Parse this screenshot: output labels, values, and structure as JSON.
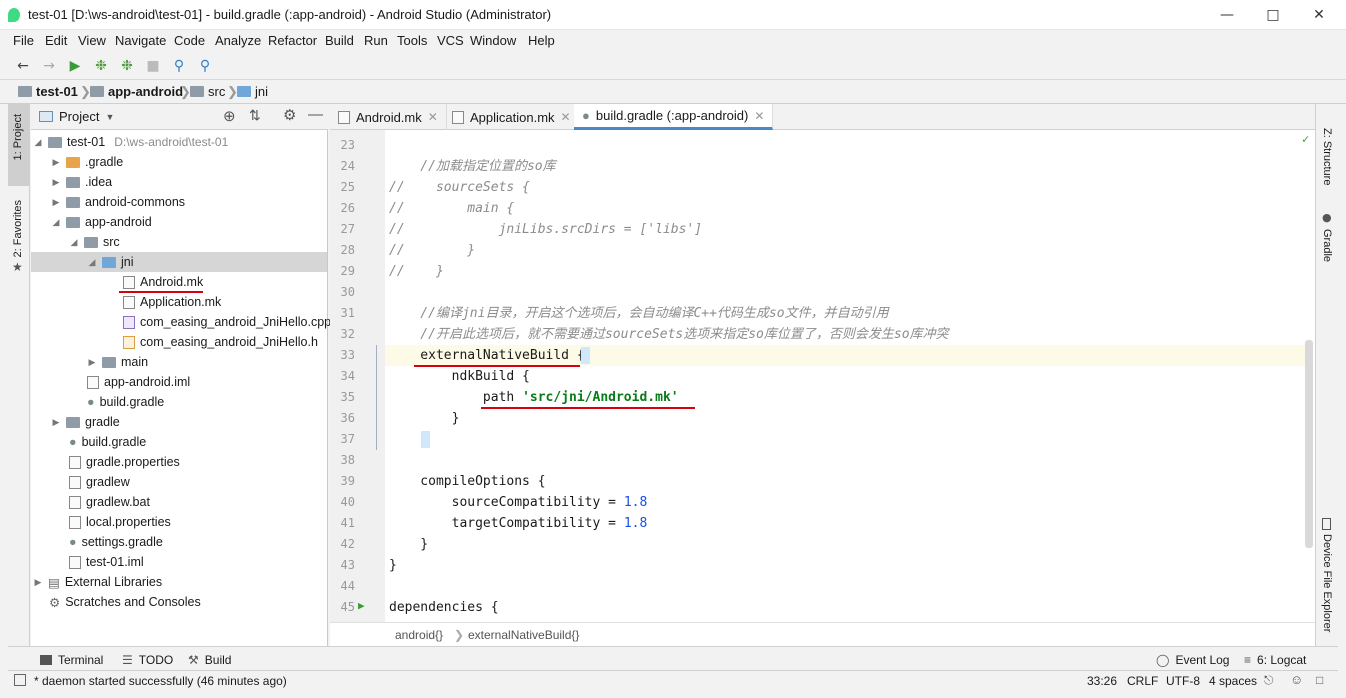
{
  "window": {
    "title": "test-01 [D:\\ws-android\\test-01] - build.gradle (:app-android) - Android Studio (Administrator)"
  },
  "menu": [
    "File",
    "Edit",
    "View",
    "Navigate",
    "Code",
    "Analyze",
    "Refactor",
    "Build",
    "Run",
    "Tools",
    "VCS",
    "Window",
    "Help"
  ],
  "breadcrumb": [
    "test-01",
    "app-android",
    "src",
    "jni"
  ],
  "project_panel": {
    "title": "Project"
  },
  "left_tabs": [
    "1: Project",
    "2: Favorites"
  ],
  "tree": [
    {
      "label": "test-01",
      "extra": "D:\\ws-android\\test-01"
    },
    {
      "label": ".gradle"
    },
    {
      "label": ".idea"
    },
    {
      "label": "android-commons"
    },
    {
      "label": "app-android"
    },
    {
      "label": "src"
    },
    {
      "label": "jni"
    },
    {
      "label": "Android.mk"
    },
    {
      "label": "Application.mk"
    },
    {
      "label": "com_easing_android_JniHello.cpp"
    },
    {
      "label": "com_easing_android_JniHello.h"
    },
    {
      "label": "main"
    },
    {
      "label": "app-android.iml"
    },
    {
      "label": "build.gradle"
    },
    {
      "label": "gradle"
    },
    {
      "label": "build.gradle"
    },
    {
      "label": "gradle.properties"
    },
    {
      "label": "gradlew"
    },
    {
      "label": "gradlew.bat"
    },
    {
      "label": "local.properties"
    },
    {
      "label": "settings.gradle"
    },
    {
      "label": "test-01.iml"
    },
    {
      "label": "External Libraries"
    },
    {
      "label": "Scratches and Consoles"
    }
  ],
  "tabs": [
    "Android.mk",
    "Application.mk",
    "build.gradle (:app-android)"
  ],
  "editor": {
    "line_numbers": [
      "23",
      "24",
      "25",
      "26",
      "27",
      "28",
      "29",
      "30",
      "31",
      "32",
      "33",
      "34",
      "35",
      "36",
      "37",
      "38",
      "39",
      "40",
      "41",
      "42",
      "43",
      "44",
      "45"
    ],
    "lines": [
      {
        "t": ""
      },
      {
        "t": "    //加载指定位置的so库",
        "c": "cm"
      },
      {
        "t": "//    sourceSets {",
        "c": "cm"
      },
      {
        "t": "//        main {",
        "c": "cm"
      },
      {
        "t": "//            jniLibs.srcDirs = ['libs']",
        "c": "cm"
      },
      {
        "t": "//        }",
        "c": "cm"
      },
      {
        "t": "//    }",
        "c": "cm"
      },
      {
        "t": ""
      },
      {
        "t": "    //编译jni目录，开启这个选项后，会自动编译C++代码生成so文件，并自动引用",
        "c": "cm"
      },
      {
        "t": "    //开启此选项后，就不需要通过sourceSets选项来指定so库位置了，否则会发生so库冲突",
        "c": "cm"
      },
      {
        "t": "    externalNativeBuild {"
      },
      {
        "t": "        ndkBuild {"
      },
      {
        "t": "            path ",
        "s": "'src/jni/Android.mk'"
      },
      {
        "t": "        }"
      },
      {
        "t": "    }"
      },
      {
        "t": ""
      },
      {
        "t": "    compileOptions {"
      },
      {
        "t": "        sourceCompatibility = ",
        "n": "1.8"
      },
      {
        "t": "        targetCompatibility = ",
        "n": "1.8"
      },
      {
        "t": "    }"
      },
      {
        "t": "}"
      },
      {
        "t": ""
      },
      {
        "t": "dependencies {"
      }
    ]
  },
  "editor_breadcrumb": [
    "android{}",
    "externalNativeBuild{}"
  ],
  "right_tabs": [
    "Z: Structure",
    "Gradle",
    "Device File Explorer"
  ],
  "bottom_tools": {
    "terminal": "Terminal",
    "todo": "TODO",
    "build": "Build",
    "event_log": "Event Log",
    "logcat": "6: Logcat"
  },
  "status": {
    "message": "* daemon started successfully (46 minutes ago)",
    "position": "33:26",
    "line_sep": "CRLF",
    "encoding": "UTF-8",
    "indent": "4 spaces"
  }
}
